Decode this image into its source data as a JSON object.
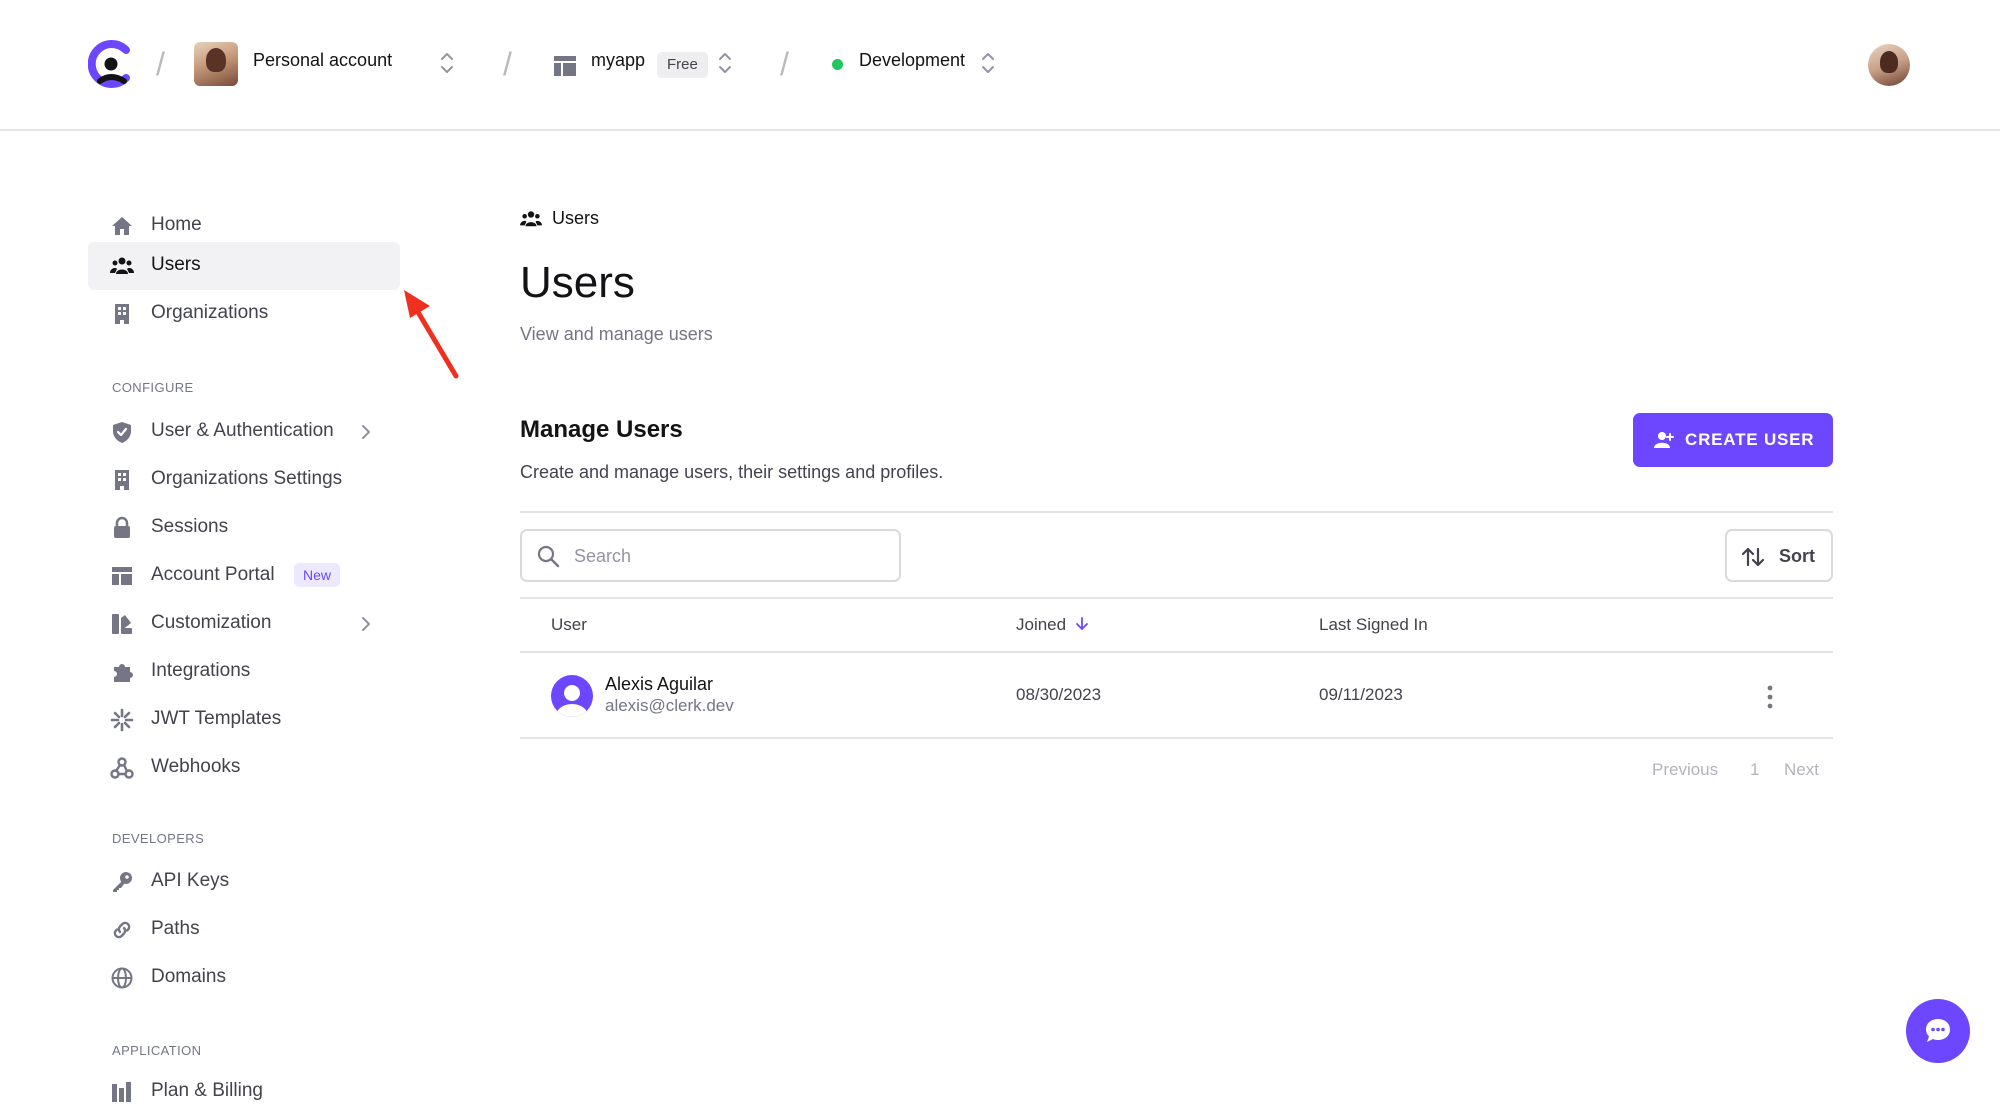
{
  "topbar": {
    "account_name": "Personal account",
    "app_name": "myapp",
    "plan_badge": "Free",
    "environment": "Development",
    "separator": "/"
  },
  "sidebar": {
    "items": [
      {
        "label": "Home",
        "icon": "home-icon",
        "active": false
      },
      {
        "label": "Users",
        "icon": "users-icon",
        "active": true
      },
      {
        "label": "Organizations",
        "icon": "building-icon",
        "active": false
      }
    ],
    "configure_label": "CONFIGURE",
    "configure_items": [
      {
        "label": "User & Authentication",
        "icon": "shield-icon",
        "has_submenu": true
      },
      {
        "label": "Organizations Settings",
        "icon": "building-icon"
      },
      {
        "label": "Sessions",
        "icon": "lock-icon"
      },
      {
        "label": "Account Portal",
        "icon": "layout-icon",
        "badge": "New"
      },
      {
        "label": "Customization",
        "icon": "paint-icon",
        "has_submenu": true
      },
      {
        "label": "Integrations",
        "icon": "puzzle-icon"
      },
      {
        "label": "JWT Templates",
        "icon": "jwt-icon"
      },
      {
        "label": "Webhooks",
        "icon": "webhook-icon"
      }
    ],
    "developers_label": "DEVELOPERS",
    "developer_items": [
      {
        "label": "API Keys",
        "icon": "key-icon"
      },
      {
        "label": "Paths",
        "icon": "link-icon"
      },
      {
        "label": "Domains",
        "icon": "globe-icon"
      }
    ],
    "application_label": "APPLICATION",
    "application_items": [
      {
        "label": "Plan & Billing",
        "icon": "billing-icon"
      }
    ]
  },
  "main": {
    "breadcrumb": "Users",
    "title": "Users",
    "subtitle": "View and manage users",
    "section_title": "Manage Users",
    "section_subtitle": "Create and manage users, their settings and profiles.",
    "create_button": "CREATE USER",
    "search_placeholder": "Search",
    "sort_button": "Sort",
    "table": {
      "columns": [
        "User",
        "Joined",
        "Last Signed In"
      ],
      "rows": [
        {
          "name": "Alexis Aguilar",
          "email": "alexis@clerk.dev",
          "joined": "08/30/2023",
          "last_signed_in": "09/11/2023"
        }
      ]
    },
    "pagination": {
      "previous": "Previous",
      "page": "1",
      "next": "Next"
    }
  },
  "colors": {
    "accent": "#6c47ff",
    "environment_dot": "#22c55e",
    "annotation_arrow": "#f0301e"
  }
}
